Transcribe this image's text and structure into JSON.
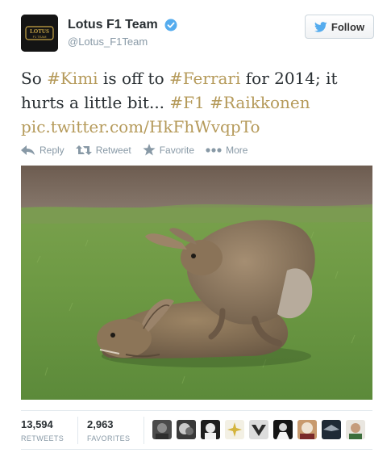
{
  "author": {
    "display_name": "Lotus F1 Team",
    "handle": "@Lotus_F1Team",
    "avatar_text_top": "LOTUS",
    "avatar_text_bottom": "F1 TEAM",
    "verified": true
  },
  "follow_button": {
    "label": "Follow",
    "icon": "twitter-bird-icon"
  },
  "tweet": {
    "segments": [
      {
        "text": "So ",
        "type": "text"
      },
      {
        "text": "#Kimi",
        "type": "hashtag"
      },
      {
        "text": " is off to ",
        "type": "text"
      },
      {
        "text": "#Ferrari",
        "type": "hashtag"
      },
      {
        "text": " for 2014; it hurts a little bit... ",
        "type": "text"
      },
      {
        "text": "#F1",
        "type": "hashtag"
      },
      {
        "text": " ",
        "type": "text"
      },
      {
        "text": "#Raikkonen",
        "type": "hashtag"
      },
      {
        "text": " ",
        "type": "text"
      },
      {
        "text": "pic.twitter.com/HkFhWvqpTo",
        "type": "link"
      }
    ]
  },
  "actions": [
    {
      "label": "Reply",
      "icon": "reply-icon"
    },
    {
      "label": "Retweet",
      "icon": "retweet-icon"
    },
    {
      "label": "Favorite",
      "icon": "star-icon"
    },
    {
      "label": "More",
      "icon": "more-dots-icon"
    }
  ],
  "stats": {
    "retweets": {
      "count": "13,594",
      "label": "RETWEETS"
    },
    "favorites": {
      "count": "2,963",
      "label": "FAVORITES"
    }
  },
  "colors": {
    "hashtag": "#b59a5a",
    "muted": "#8899a6",
    "text": "#292f33",
    "verified": "#55acee",
    "twitter_blue": "#55acee"
  },
  "favoriters_count_shown": 9
}
